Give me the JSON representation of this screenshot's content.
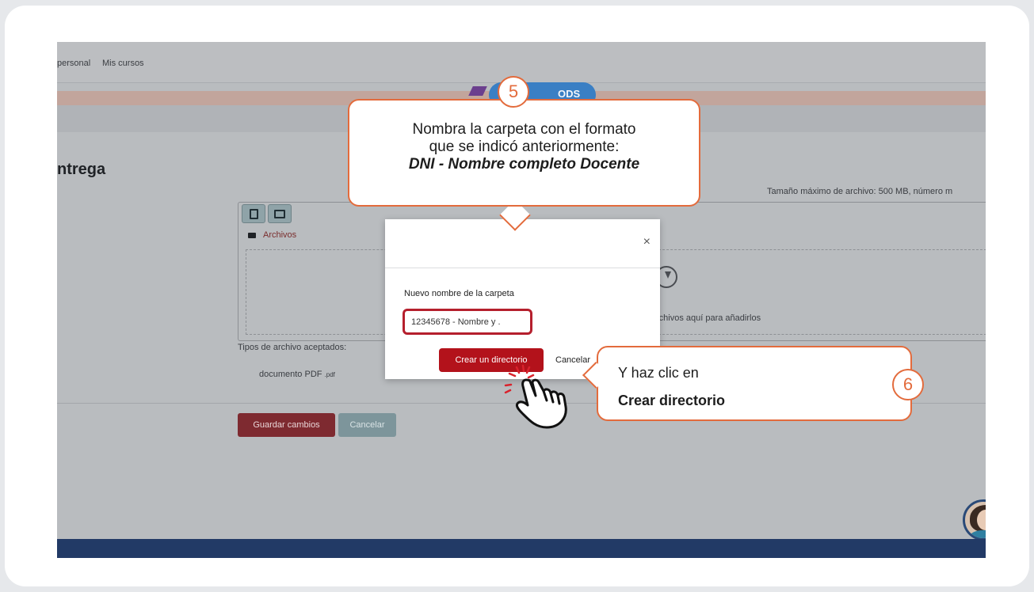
{
  "topnav": {
    "link_personal": "personal",
    "link_mis_cursos": "Mis cursos"
  },
  "ods_label": "ODS",
  "page_heading": "ntrega",
  "max_size_text": "Tamaño máximo de archivo: 500 MB, número m",
  "filepicker": {
    "breadcrumb": "Archivos",
    "drop_hint": "rchivos aquí para añadirlos"
  },
  "accepted_types": {
    "label": "Tipos de archivo aceptados:",
    "pdf_name": "documento PDF",
    "pdf_ext": ".pdf"
  },
  "page_buttons": {
    "save": "Guardar cambios",
    "cancel": "Cancelar"
  },
  "modal": {
    "close_glyph": "×",
    "field_label": "Nuevo nombre de la carpeta",
    "field_value": "12345678 - Nombre y .",
    "create_button": "Crear un directorio",
    "cancel_button": "Cancelar"
  },
  "callout_5": {
    "step": "5",
    "line1": "Nombra la carpeta con el formato",
    "line2": "que se indicó anteriormente:",
    "line3": "DNI - Nombre completo Docente"
  },
  "callout_6": {
    "step": "6",
    "line1": "Y haz clic en",
    "line2": "Crear directorio"
  },
  "colors": {
    "accent_orange": "#e36b3c",
    "create_button_red": "#b3121b",
    "footer_navy": "#223a66"
  }
}
